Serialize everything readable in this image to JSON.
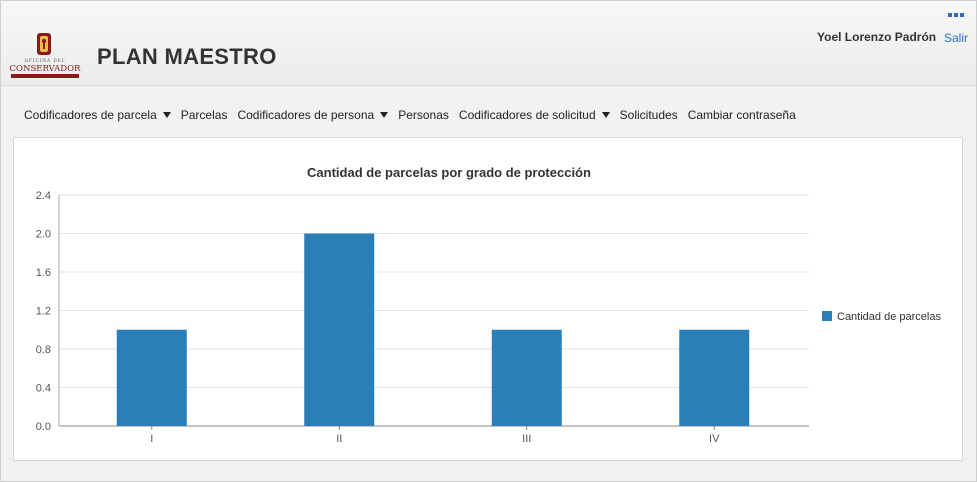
{
  "app": {
    "title": "PLAN MAESTRO",
    "logo": {
      "top_text": "OFICINA DEL",
      "main_text": "CONSERVADOR",
      "icon": "key-emblem-icon"
    }
  },
  "user": {
    "name": "Yoel Lorenzo Padrón",
    "logout_label": "Salir"
  },
  "nav": {
    "items": [
      {
        "label": "Codificadores de parcela",
        "dropdown": true
      },
      {
        "label": "Parcelas",
        "dropdown": false
      },
      {
        "label": "Codificadores de persona",
        "dropdown": true
      },
      {
        "label": "Personas",
        "dropdown": false
      },
      {
        "label": "Codificadores de solicitud",
        "dropdown": true
      },
      {
        "label": "Solicitudes",
        "dropdown": false
      },
      {
        "label": "Cambiar contraseña",
        "dropdown": false
      }
    ]
  },
  "colors": {
    "bar": "#2a7fb8",
    "link": "#2a6fbf"
  },
  "chart_data": {
    "type": "bar",
    "title": "Cantidad de parcelas por grado de protección",
    "categories": [
      "I",
      "II",
      "III",
      "IV"
    ],
    "series": [
      {
        "name": "Cantidad de parcelas",
        "values": [
          1,
          2,
          1,
          1
        ]
      }
    ],
    "ylim": [
      0,
      2.4
    ],
    "yticks": [
      "0.0",
      "0.4",
      "0.8",
      "1.2",
      "1.6",
      "2.0",
      "2.4"
    ],
    "grid": true,
    "legend": "right"
  }
}
